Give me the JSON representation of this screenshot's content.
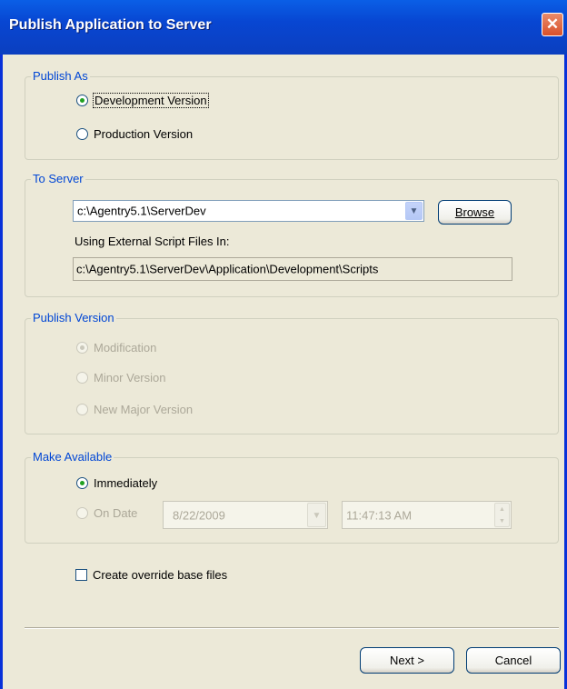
{
  "window": {
    "title": "Publish Application to Server",
    "close_symbol": "✕"
  },
  "publish_as": {
    "legend": "Publish As",
    "options": [
      {
        "label": "Development Version",
        "checked": true
      },
      {
        "label": "Production Version",
        "checked": false
      }
    ]
  },
  "to_server": {
    "legend": "To Server",
    "server_path": "c:\\Agentry5.1\\ServerDev",
    "browse_label": "Browse",
    "script_label": "Using External Script Files In:",
    "script_path": "c:\\Agentry5.1\\ServerDev\\Application\\Development\\Scripts"
  },
  "publish_version": {
    "legend": "Publish Version",
    "options": [
      {
        "label": "Modification",
        "checked": true
      },
      {
        "label": "Minor Version",
        "checked": false
      },
      {
        "label": "New Major Version",
        "checked": false
      }
    ]
  },
  "make_available": {
    "legend": "Make Available",
    "immediately_label": "Immediately",
    "on_date_label": "On Date",
    "date_value": "8/22/2009",
    "time_value": "11:47:13 AM"
  },
  "override": {
    "label": "Create override base files",
    "checked": false
  },
  "footer": {
    "next_label": "Next >",
    "cancel_label": "Cancel"
  },
  "icons": {
    "dropdown_arrow": "▼",
    "spin_up": "▲",
    "spin_down": "▼"
  }
}
